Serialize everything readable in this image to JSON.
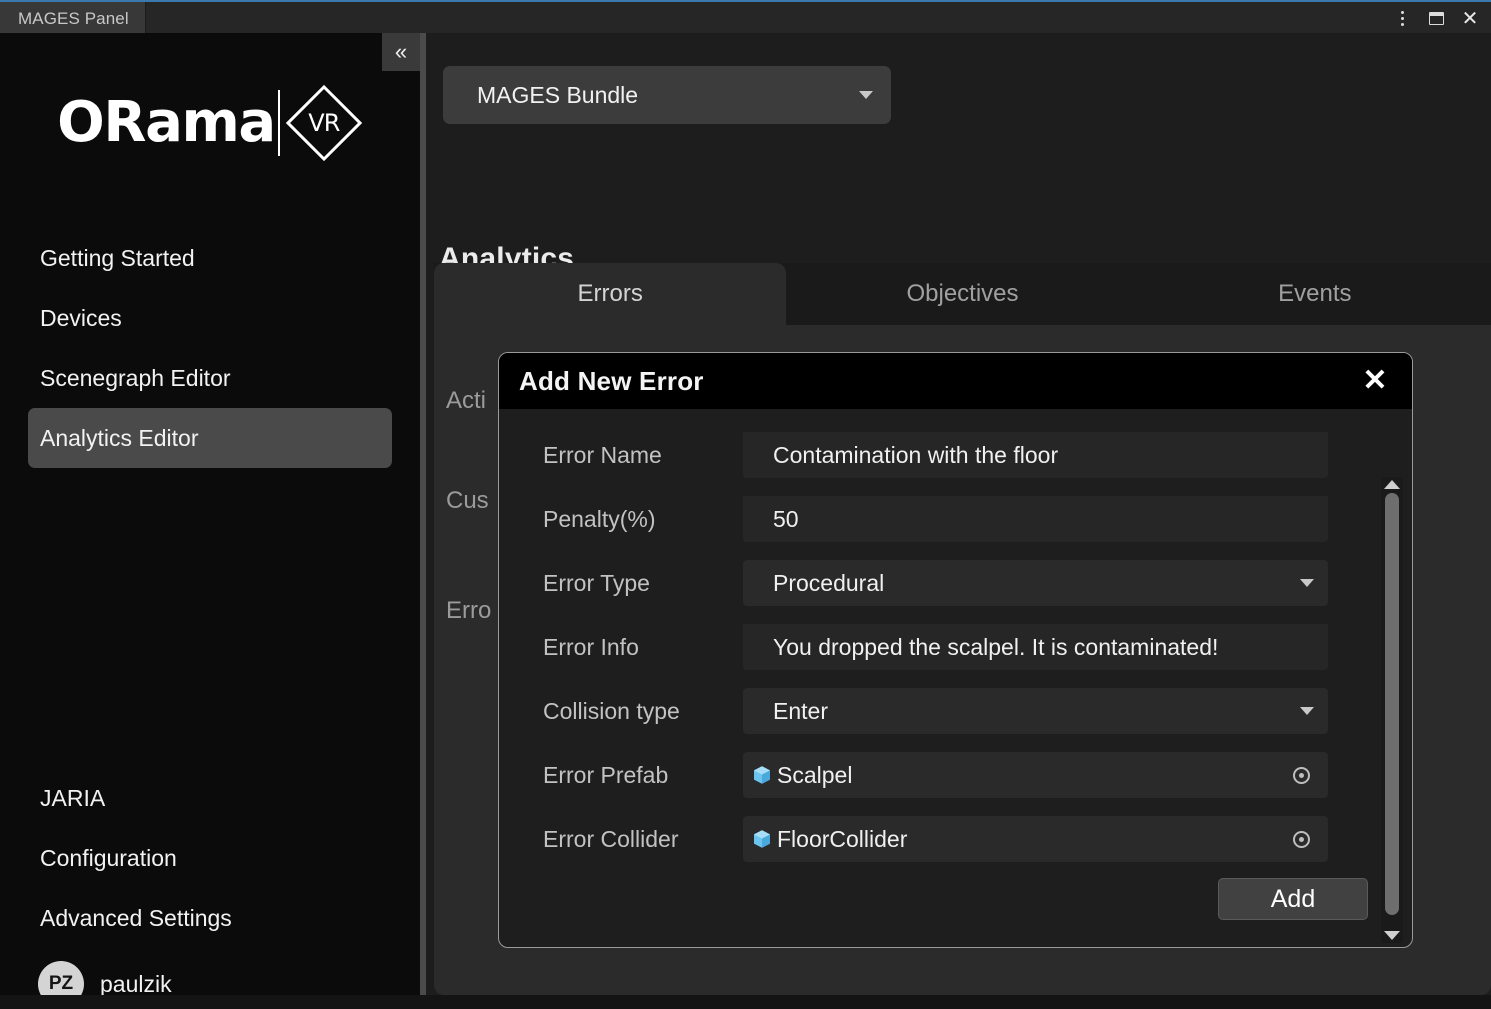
{
  "window": {
    "tab_label": "MAGES Panel",
    "controls": {
      "menu": "kebab-menu-icon",
      "maximize": "maximize-icon",
      "close": "close-icon"
    }
  },
  "sidebar": {
    "collapse_glyph": "«",
    "logo": {
      "text": "ORama",
      "badge": "VR"
    },
    "items_top": [
      {
        "label": "Getting Started",
        "active": false
      },
      {
        "label": "Devices",
        "active": false
      },
      {
        "label": "Scenegraph Editor",
        "active": false
      },
      {
        "label": "Analytics Editor",
        "active": true
      }
    ],
    "items_bottom": [
      {
        "label": "JARIA"
      },
      {
        "label": "Configuration"
      },
      {
        "label": "Advanced Settings"
      }
    ],
    "user": {
      "initials": "PZ",
      "name": "paulzik"
    }
  },
  "main": {
    "bundle_select": {
      "value": "MAGES Bundle"
    },
    "section_title": "Analytics",
    "tabs": [
      {
        "label": "Errors",
        "active": true
      },
      {
        "label": "Objectives",
        "active": false
      },
      {
        "label": "Events",
        "active": false
      }
    ],
    "panel_labels": [
      "Acti",
      "Cus",
      "Erro"
    ]
  },
  "modal": {
    "title": "Add New Error",
    "close_glyph": "✕",
    "fields": [
      {
        "label": "Error Name",
        "value": "Contamination with the floor",
        "kind": "text"
      },
      {
        "label": "Penalty(%)",
        "value": "50",
        "kind": "text"
      },
      {
        "label": "Error Type",
        "value": "Procedural",
        "kind": "dropdown"
      },
      {
        "label": "Error Info",
        "value": "You dropped the scalpel. It is contaminated!",
        "kind": "text"
      },
      {
        "label": "Collision type",
        "value": "Enter",
        "kind": "dropdown"
      },
      {
        "label": "Error Prefab",
        "value": "Scalpel",
        "kind": "object"
      },
      {
        "label": "Error Collider",
        "value": "FloorCollider",
        "kind": "object"
      }
    ],
    "add_button": "Add"
  },
  "colors": {
    "accent_tab_top": "#3a79ad",
    "sidebar_bg": "#0b0b0b",
    "panel_bg": "#2b2b2b",
    "modal_bg": "#1e1e1e",
    "modal_header_bg": "#000000",
    "active_nav_bg": "#4a4a4a",
    "prefab_icon": "#6cc4f0"
  }
}
